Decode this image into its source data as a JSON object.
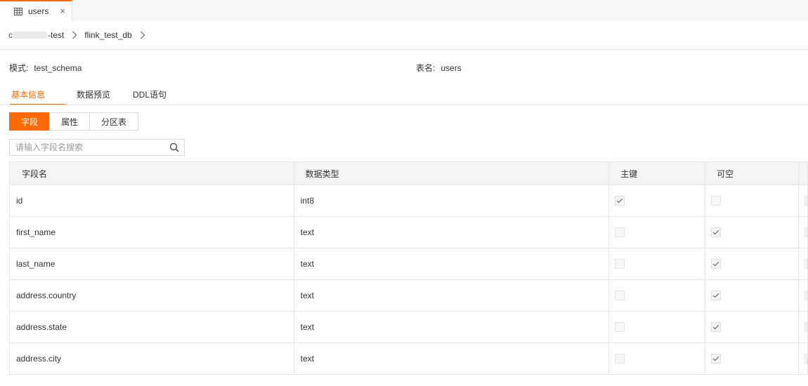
{
  "tab": {
    "label": "users",
    "close": "×"
  },
  "breadcrumb": {
    "conn_prefix": "c",
    "conn_suffix": "-test",
    "db": "flink_test_db"
  },
  "meta": {
    "schema_label": "模式:",
    "schema_value": "test_schema",
    "table_label": "表名:",
    "table_value": "users"
  },
  "tabs": [
    "基本信息",
    "数据预览",
    "DDL语句"
  ],
  "segments": [
    "字段",
    "属性",
    "分区表"
  ],
  "search": {
    "placeholder": "请输入字段名搜索"
  },
  "table": {
    "headers": [
      "字段名",
      "数据类型",
      "主键",
      "可空"
    ],
    "rows": [
      {
        "name": "id",
        "type": "int8",
        "pk": true,
        "nullable": false
      },
      {
        "name": "first_name",
        "type": "text",
        "pk": false,
        "nullable": true
      },
      {
        "name": "last_name",
        "type": "text",
        "pk": false,
        "nullable": true
      },
      {
        "name": "address.country",
        "type": "text",
        "pk": false,
        "nullable": true
      },
      {
        "name": "address.state",
        "type": "text",
        "pk": false,
        "nullable": true
      },
      {
        "name": "address.city",
        "type": "text",
        "pk": false,
        "nullable": true
      }
    ]
  },
  "colors": {
    "accent": "#ff6a00",
    "border": "#e5e5e5",
    "header_bg": "#f5f5f5"
  }
}
